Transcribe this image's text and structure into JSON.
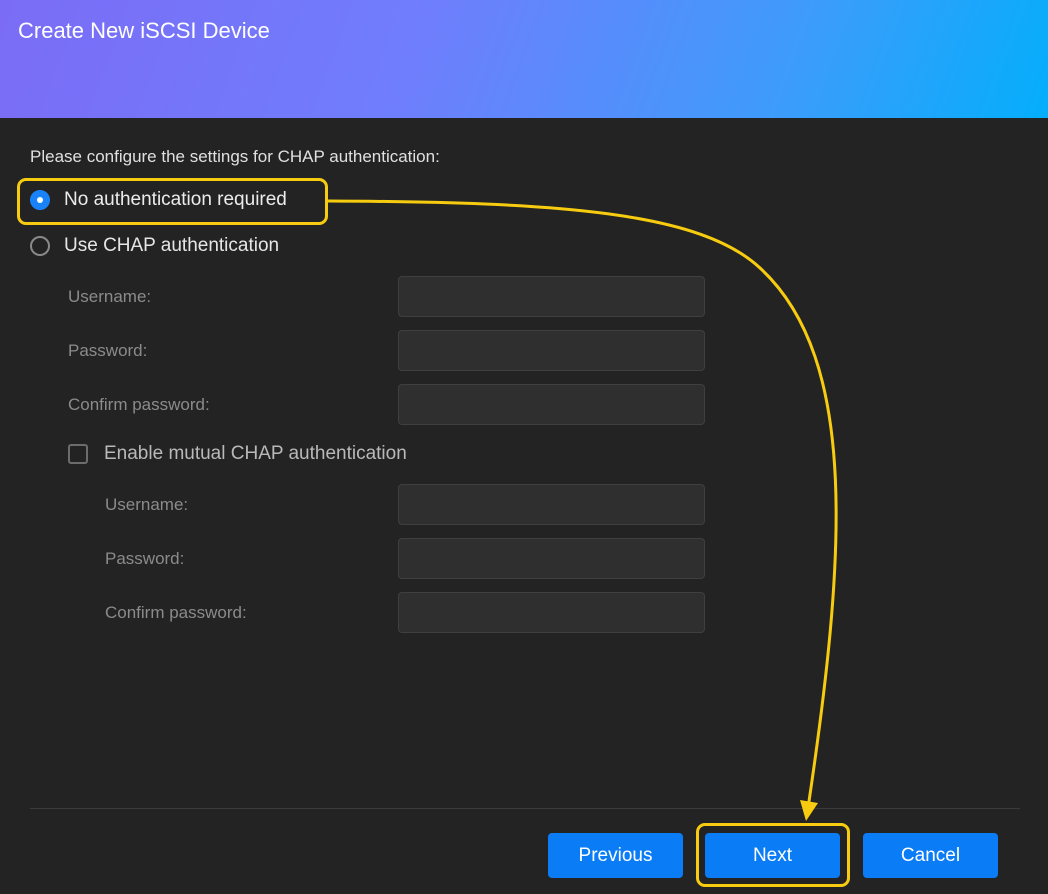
{
  "dialog": {
    "title": "Create New iSCSI Device",
    "instruction": "Please configure the settings for CHAP authentication:"
  },
  "auth_options": [
    {
      "label": "No authentication required",
      "selected": true
    },
    {
      "label": "Use CHAP authentication",
      "selected": false
    }
  ],
  "chap_fields": [
    {
      "label": "Username:",
      "value": ""
    },
    {
      "label": "Password:",
      "value": ""
    },
    {
      "label": "Confirm password:",
      "value": ""
    }
  ],
  "mutual_chap": {
    "label": "Enable mutual CHAP authentication",
    "checked": false,
    "fields": [
      {
        "label": "Username:",
        "value": ""
      },
      {
        "label": "Password:",
        "value": ""
      },
      {
        "label": "Confirm password:",
        "value": ""
      }
    ]
  },
  "footer": {
    "previous_label": "Previous",
    "next_label": "Next",
    "cancel_label": "Cancel"
  },
  "colors": {
    "accent": "#0a7cf6",
    "highlight": "#f7cc10",
    "background": "#232323"
  }
}
